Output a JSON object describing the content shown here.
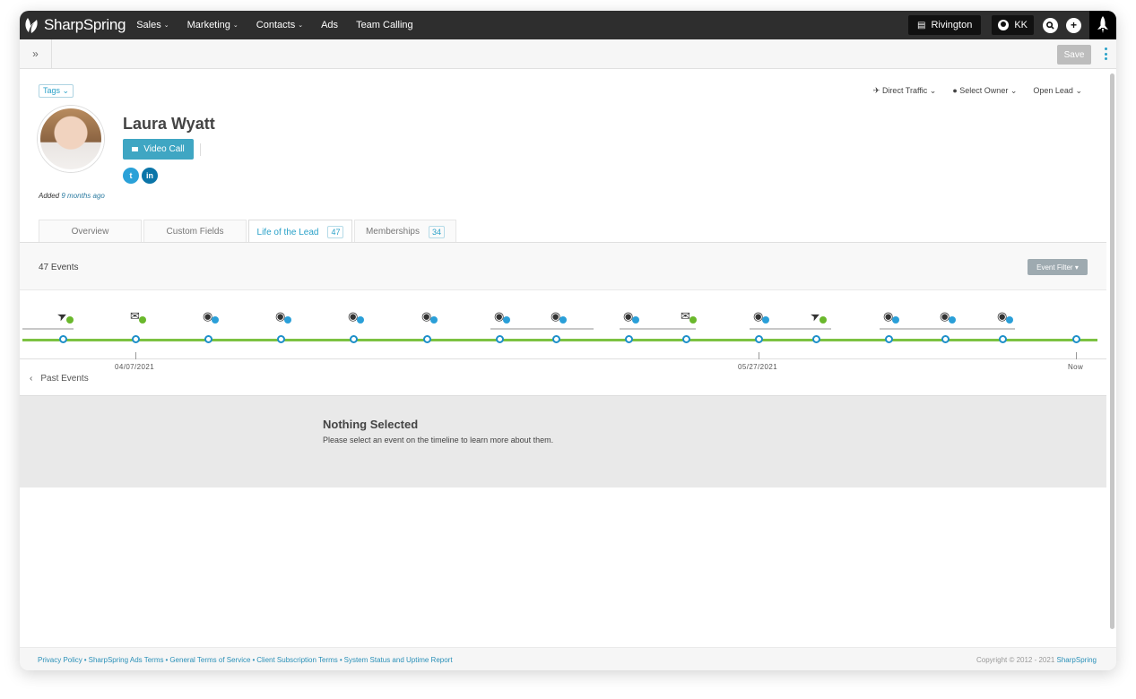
{
  "nav": {
    "brand": "SharpSpring",
    "items": [
      {
        "label": "Sales",
        "dropdown": true
      },
      {
        "label": "Marketing",
        "dropdown": true
      },
      {
        "label": "Contacts",
        "dropdown": true
      },
      {
        "label": "Ads",
        "dropdown": false
      },
      {
        "label": "Team Calling",
        "dropdown": false
      }
    ],
    "account": "Rivington",
    "user": "KK"
  },
  "toolbar": {
    "save_label": "Save"
  },
  "contact": {
    "tags_label": "Tags",
    "name": "Laura Wyatt",
    "video_call_label": "Video Call",
    "added_prefix": "Added",
    "added_ago": "9 months ago",
    "source": "Direct Traffic",
    "owner": "Select Owner",
    "status": "Open Lead"
  },
  "tabs": [
    {
      "label": "Overview",
      "count": ""
    },
    {
      "label": "Custom Fields",
      "count": ""
    },
    {
      "label": "Life of the Lead",
      "count": "47"
    },
    {
      "label": "Memberships",
      "count": "34"
    }
  ],
  "events": {
    "count_label": "47 Events",
    "filter_label": "Event Filter",
    "past_label": "Past Events",
    "dates": [
      "04/07/2021",
      "05/27/2021",
      "Now"
    ]
  },
  "detail": {
    "title": "Nothing Selected",
    "message": "Please select an event on the timeline to learn more about them."
  },
  "footer": {
    "links": [
      "Privacy Policy",
      "SharpSpring Ads Terms",
      "General Terms of Service",
      "Client Subscription Terms",
      "System Status and Uptime Report"
    ],
    "copyright_prefix": "Copyright © 2012 - 2021",
    "copyright_brand": "SharpSpring"
  },
  "colors": {
    "accent": "#2aa1c8",
    "timeline": "#7cc242",
    "topbar": "#2e2e2e"
  }
}
